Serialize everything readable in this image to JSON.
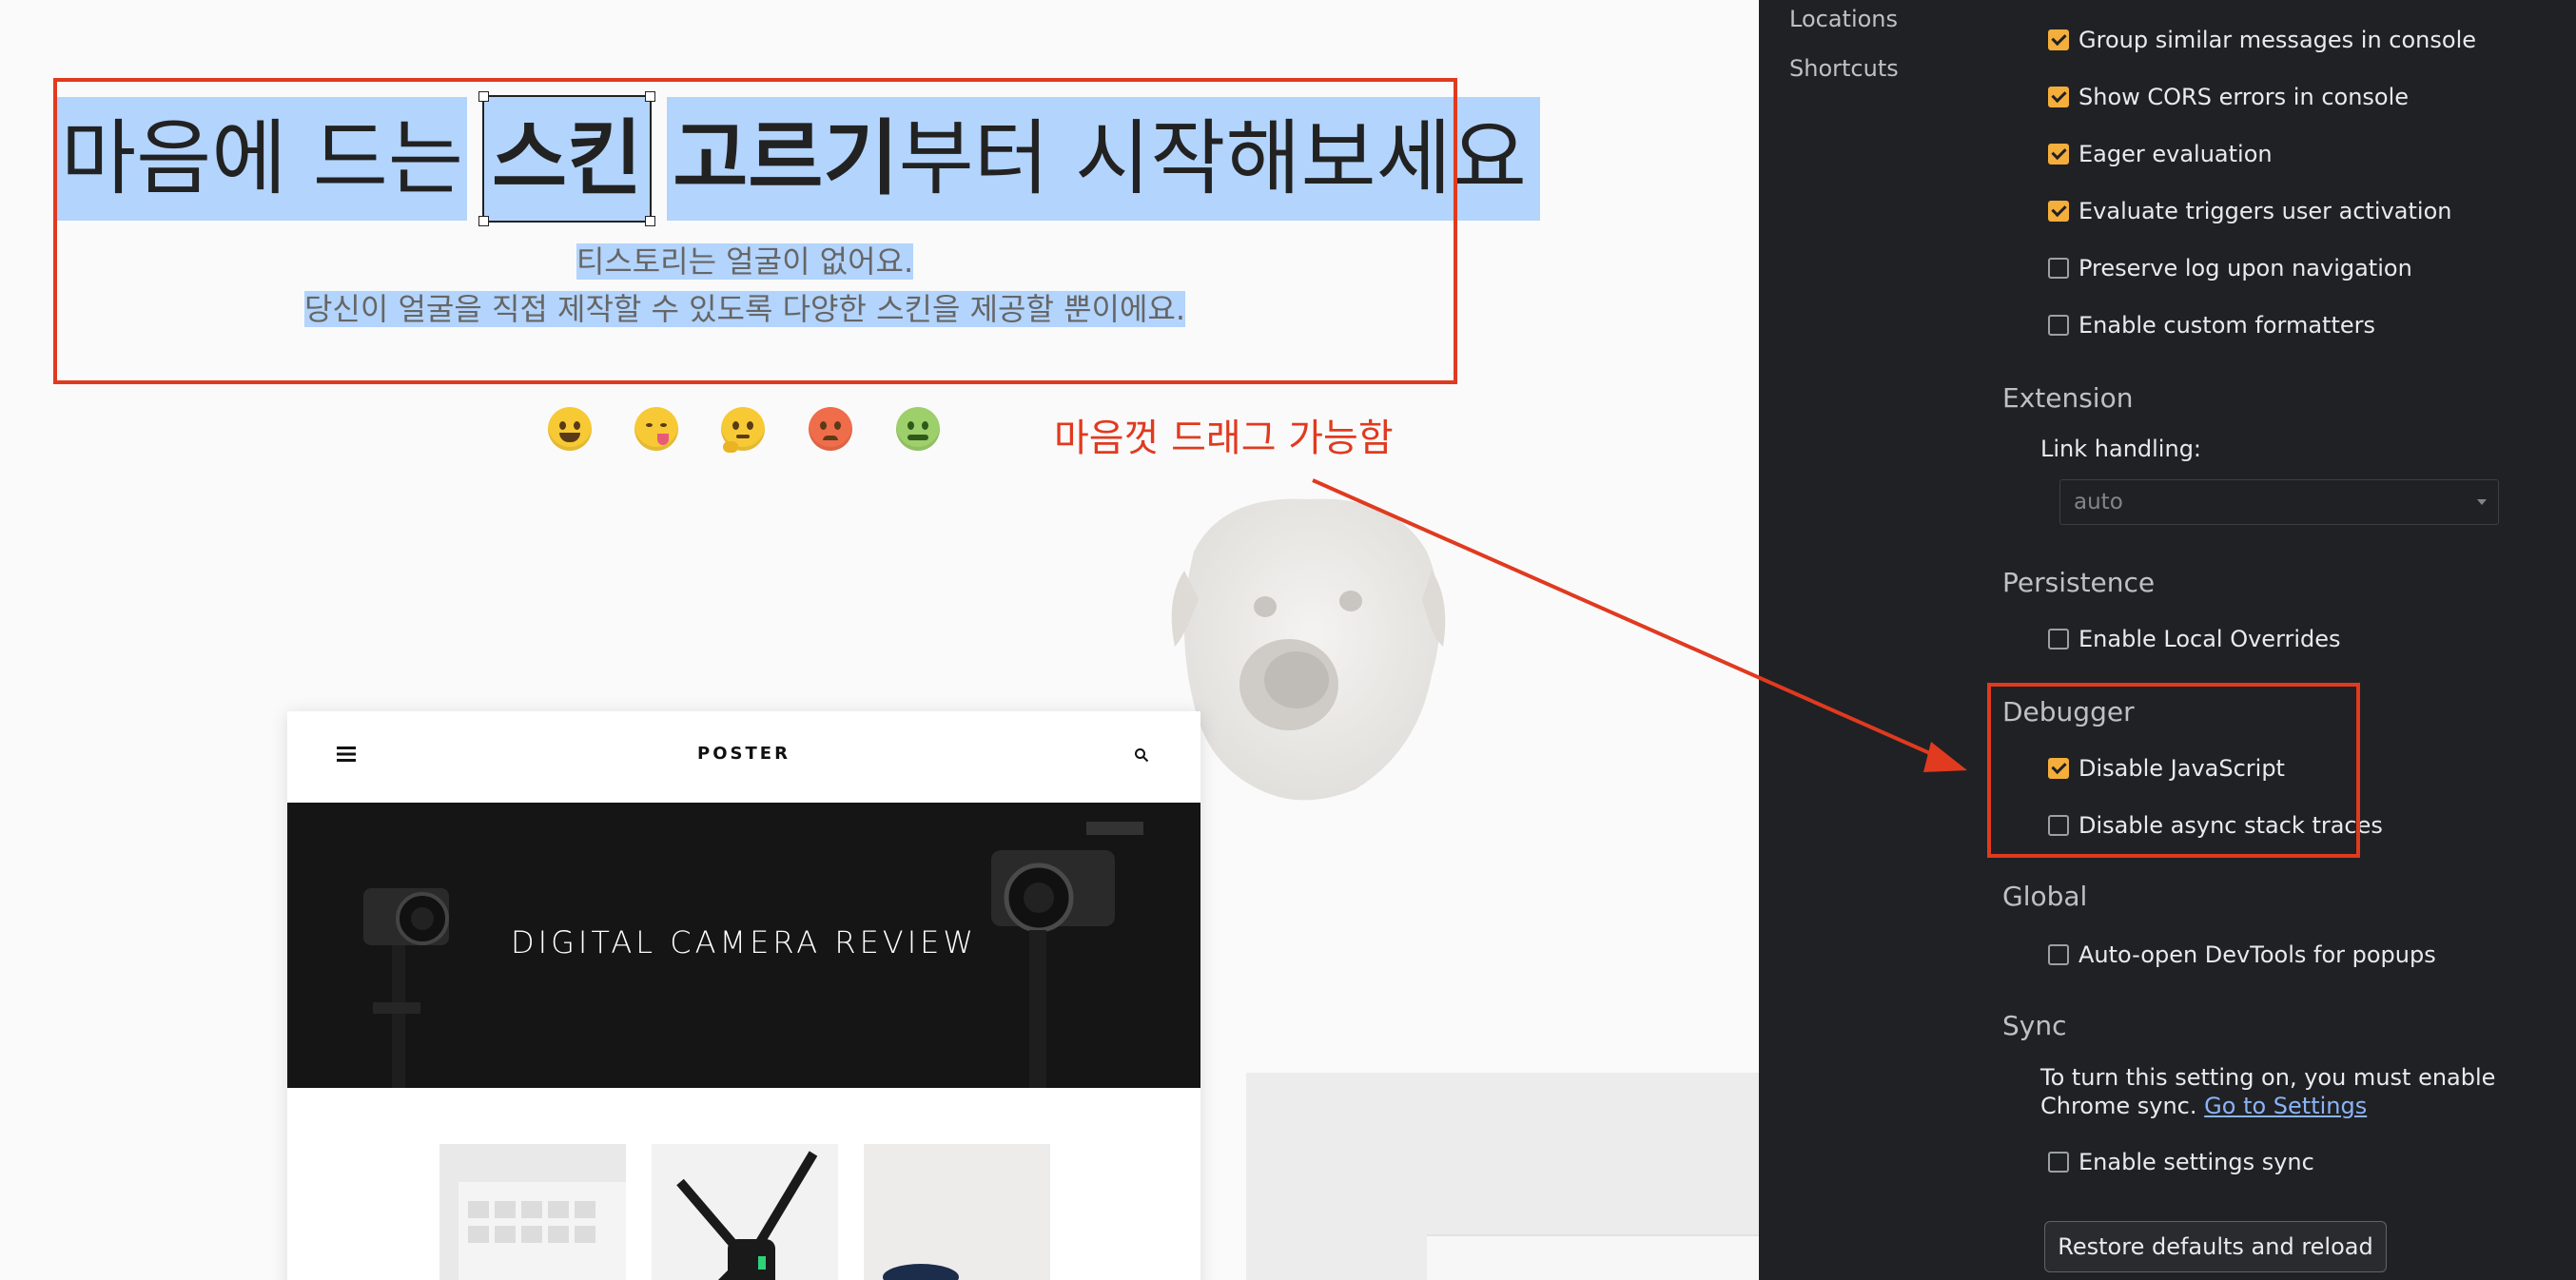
{
  "hero": {
    "title_part1": "마음에 드는",
    "title_skin": "스킨",
    "title_bold2": "고르기",
    "title_part3": "부터 시작해보세요",
    "subtitle_line1": "티스토리는 얼굴이 없어요.",
    "subtitle_line2": "당신이 얼굴을 직접 제작할 수 있도록 다양한 스킨을 제공할 뿐이에요."
  },
  "annotation": "마음껏 드래그 가능함",
  "emojis": [
    "grinning-emoji",
    "yum-emoji",
    "thinking-emoji",
    "angry-emoji",
    "nauseated-emoji"
  ],
  "poster": {
    "logo": "POSTER",
    "hero_title": "DIGITAL CAMERA REVIEW"
  },
  "devtools": {
    "nav": [
      "Locations",
      "Shortcuts"
    ],
    "console_options": [
      {
        "label": "Group similar messages in console",
        "checked": true
      },
      {
        "label": "Show CORS errors in console",
        "checked": true
      },
      {
        "label": "Eager evaluation",
        "checked": true
      },
      {
        "label": "Evaluate triggers user activation",
        "checked": true
      },
      {
        "label": "Preserve log upon navigation",
        "checked": false
      },
      {
        "label": "Enable custom formatters",
        "checked": false
      }
    ],
    "extension": {
      "title": "Extension",
      "link_handling_label": "Link handling:",
      "link_handling_value": "auto"
    },
    "persistence": {
      "title": "Persistence",
      "options": [
        {
          "label": "Enable Local Overrides",
          "checked": false
        }
      ]
    },
    "debugger": {
      "title": "Debugger",
      "options": [
        {
          "label": "Disable JavaScript",
          "checked": true
        },
        {
          "label": "Disable async stack traces",
          "checked": false
        }
      ]
    },
    "global": {
      "title": "Global",
      "options": [
        {
          "label": "Auto-open DevTools for popups",
          "checked": false
        }
      ]
    },
    "sync": {
      "title": "Sync",
      "text": "To turn this setting on, you must enable Chrome sync.",
      "link": "Go to Settings",
      "options": [
        {
          "label": "Enable settings sync",
          "checked": false
        }
      ]
    },
    "restore_button": "Restore defaults and reload"
  },
  "colors": {
    "annotation_red": "#e03a1f",
    "selection_blue": "#b3d4fc",
    "checkbox_orange": "#f4ae3c",
    "devtools_bg": "#202124",
    "link_blue": "#8ab4f8"
  }
}
